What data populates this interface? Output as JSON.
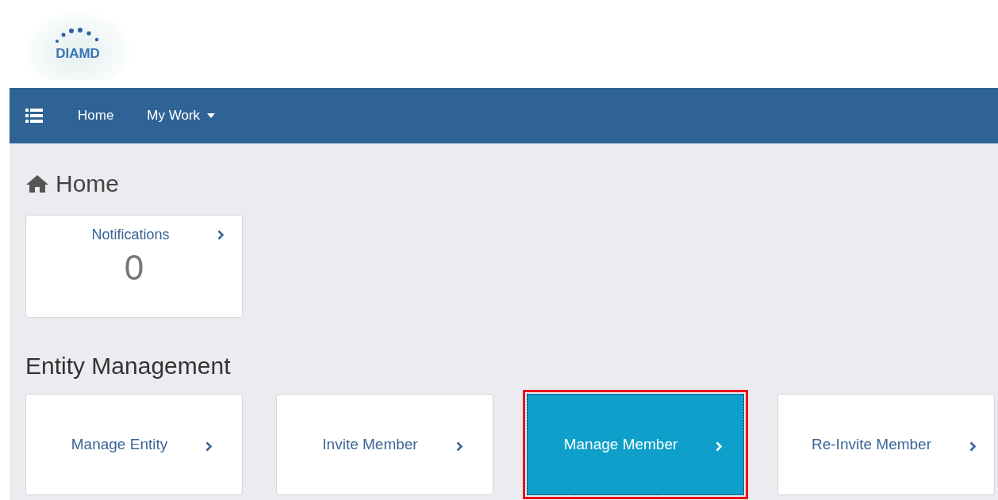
{
  "logo": {
    "text": "DIAMD"
  },
  "navbar": {
    "items": [
      {
        "label": "Home",
        "kind": "link"
      },
      {
        "label": "My Work",
        "kind": "dropdown"
      }
    ]
  },
  "page_title": "Home",
  "notifications": {
    "label": "Notifications",
    "count": "0"
  },
  "section_title": "Entity Management",
  "tiles": [
    {
      "label": "Manage Entity",
      "selected": false
    },
    {
      "label": "Invite Member",
      "selected": false
    },
    {
      "label": "Manage Member",
      "selected": true
    },
    {
      "label": "Re-Invite Member",
      "selected": false
    }
  ]
}
